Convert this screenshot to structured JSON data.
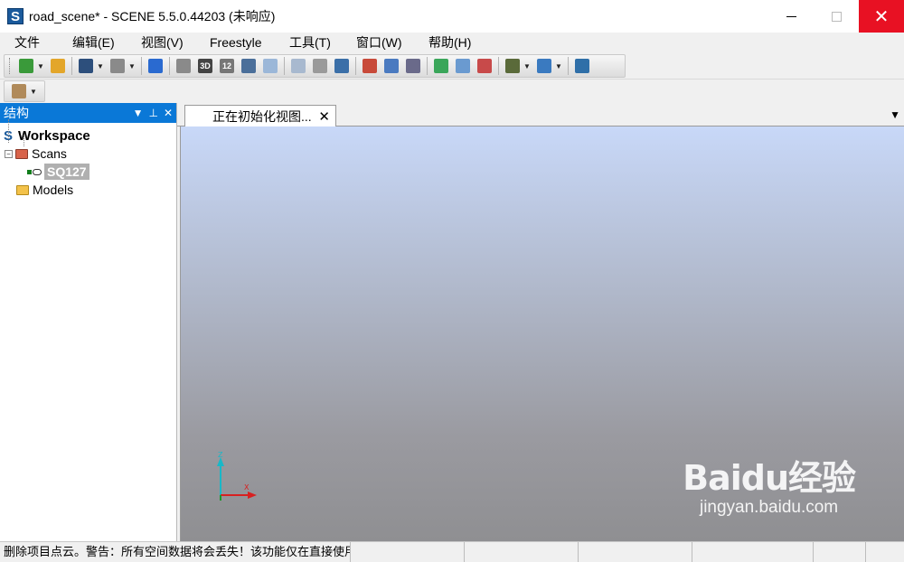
{
  "window": {
    "app_icon_letter": "S",
    "title": "road_scene* - SCENE 5.5.0.44203 (未响应)",
    "close_glyph": "✕"
  },
  "menu": [
    "文件(F)",
    "编辑(E)",
    "视图(V)",
    "Freestyle",
    "工具(T)",
    "窗口(W)",
    "帮助(H)"
  ],
  "toolbar": {
    "buttons": [
      {
        "icon": "new-project-icon",
        "color": "#3a9a3a",
        "has_dropdown": true
      },
      {
        "icon": "open-project-icon",
        "color": "#e3a62a",
        "has_dropdown": false
      },
      {
        "icon": "save-icon",
        "color": "#2d4f7c",
        "has_dropdown": true
      },
      {
        "icon": "print-icon",
        "color": "#8a8a8a",
        "has_dropdown": true
      },
      {
        "icon": "help-icon",
        "color": "#2a6ad0",
        "has_dropdown": false
      },
      {
        "icon": "quick-view-icon",
        "color": "#8a8a8a",
        "has_dropdown": false
      },
      {
        "icon": "3d-view-icon",
        "color": "#444444",
        "text": "3D",
        "has_dropdown": false
      },
      {
        "icon": "planar-view-icon",
        "color": "#777777",
        "text": "12",
        "has_dropdown": false
      },
      {
        "icon": "home-view-icon",
        "color": "#4b6f9a",
        "has_dropdown": false
      },
      {
        "icon": "picture-icon",
        "color": "#9bb7d8",
        "has_dropdown": false
      },
      {
        "icon": "layout-icon",
        "color": "#a8b9cf",
        "has_dropdown": false
      },
      {
        "icon": "cloud-print-icon",
        "color": "#9a9a9a",
        "has_dropdown": false
      },
      {
        "icon": "import-icon",
        "color": "#3b6fa8",
        "has_dropdown": false
      },
      {
        "icon": "calendar-icon",
        "color": "#c84a3a",
        "has_dropdown": false
      },
      {
        "icon": "export-icon",
        "color": "#4a7ac0",
        "has_dropdown": false
      },
      {
        "icon": "register-icon",
        "color": "#6a6a8a",
        "has_dropdown": false
      },
      {
        "icon": "add-cloud-icon",
        "color": "#3aa65a",
        "has_dropdown": false
      },
      {
        "icon": "cloud-icon",
        "color": "#6a9ad0",
        "has_dropdown": false
      },
      {
        "icon": "delete-cloud-icon",
        "color": "#c84a4a",
        "has_dropdown": false
      },
      {
        "icon": "camera-icon",
        "color": "#5a6a3a",
        "has_dropdown": true
      },
      {
        "icon": "layer-icon",
        "color": "#3a7ac0",
        "has_dropdown": true
      },
      {
        "icon": "globe-icon",
        "color": "#2f6fa8",
        "has_dropdown": false
      }
    ],
    "second_row_icon": "scan-manager-icon"
  },
  "structure_panel": {
    "title": "结构",
    "tree": {
      "workspace_letter": "S",
      "workspace": "Workspace",
      "scans": "Scans",
      "scan_item": "SQ127",
      "models": "Models"
    }
  },
  "view": {
    "tab_title": "正在初始化视图...",
    "axis_labels": {
      "z": "Z",
      "x": "X"
    },
    "colors": {
      "top": "#c8d8f8",
      "bottom": "#8f8f92"
    }
  },
  "watermark": {
    "logo": "Baidu经验",
    "url": "jingyan.baidu.com"
  },
  "status": {
    "message": "删除项目点云。警告：所有空间数据将会丢失！该功能仅在直接使用"
  }
}
